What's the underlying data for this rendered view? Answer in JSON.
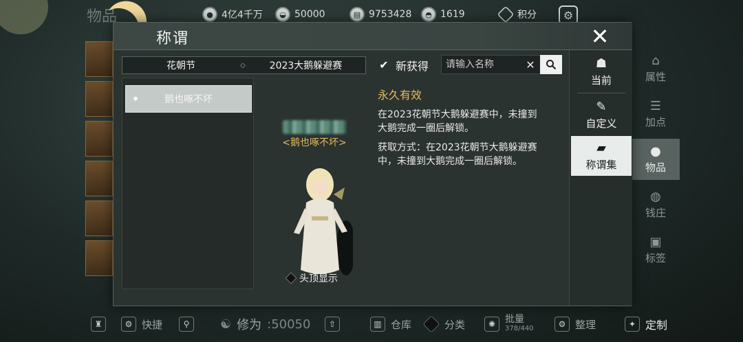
{
  "currencies": [
    {
      "icon": "coin-stack-icon",
      "value": "4亿4千万"
    },
    {
      "icon": "silver-ingot-icon",
      "value": "50000"
    },
    {
      "icon": "jade-note-icon",
      "value": "9753428"
    },
    {
      "icon": "gold-ingot-icon",
      "value": "1619"
    }
  ],
  "score": {
    "label": "积分"
  },
  "background_title": "物品",
  "dialog": {
    "title": "称谓",
    "close_symbol": "✕"
  },
  "filter": {
    "category": "花朝节",
    "separator": "◇",
    "event": "2023大鹅躲避赛"
  },
  "new_checkbox": {
    "checked": true,
    "check_symbol": "✔",
    "label": "新获得"
  },
  "search": {
    "placeholder": "请输入名称",
    "clear_symbol": "✕"
  },
  "title_list": [
    {
      "marker": "◆",
      "label": "鹅也啄不坏",
      "selected": true
    }
  ],
  "preview": {
    "title_label": "<鹅也啄不坏>",
    "show_overhead_label": "头顶显示"
  },
  "detail": {
    "duration": "永久有效",
    "description": "在2023花朝节大鹅躲避赛中，未撞到大鹅完成一圈后解锁。",
    "acquire": "获取方式：在2023花朝节大鹅躲避赛中，未撞到大鹅完成一圈后解锁。"
  },
  "tabs": [
    {
      "label": "当前",
      "icon": "character-icon",
      "active": false
    },
    {
      "label": "自定义",
      "icon": "brush-icon",
      "active": false
    },
    {
      "label": "称谓集",
      "icon": "scroll-icon",
      "active": true
    }
  ],
  "right_menu": [
    {
      "label": "属性",
      "icon": "hat-icon",
      "active": false
    },
    {
      "label": "加点",
      "icon": "sliders-icon",
      "active": false
    },
    {
      "label": "物品",
      "icon": "bag-icon",
      "active": true
    },
    {
      "label": "钱庄",
      "icon": "moneybag-icon",
      "active": false
    },
    {
      "label": "标签",
      "icon": "tag-icon",
      "active": false
    }
  ],
  "bottom": {
    "shortcut": "快捷",
    "cultivation_label": "修为",
    "cultivation_value": ":50050",
    "warehouse": "仓库",
    "classify": "分类",
    "batch": "批量",
    "batch_count": "378/440",
    "arrange": "整理",
    "custom": "定制"
  },
  "colors": {
    "accent_gold": "#e6b95c",
    "panel": "#2b3331",
    "active_tab": "#e8ecea"
  }
}
